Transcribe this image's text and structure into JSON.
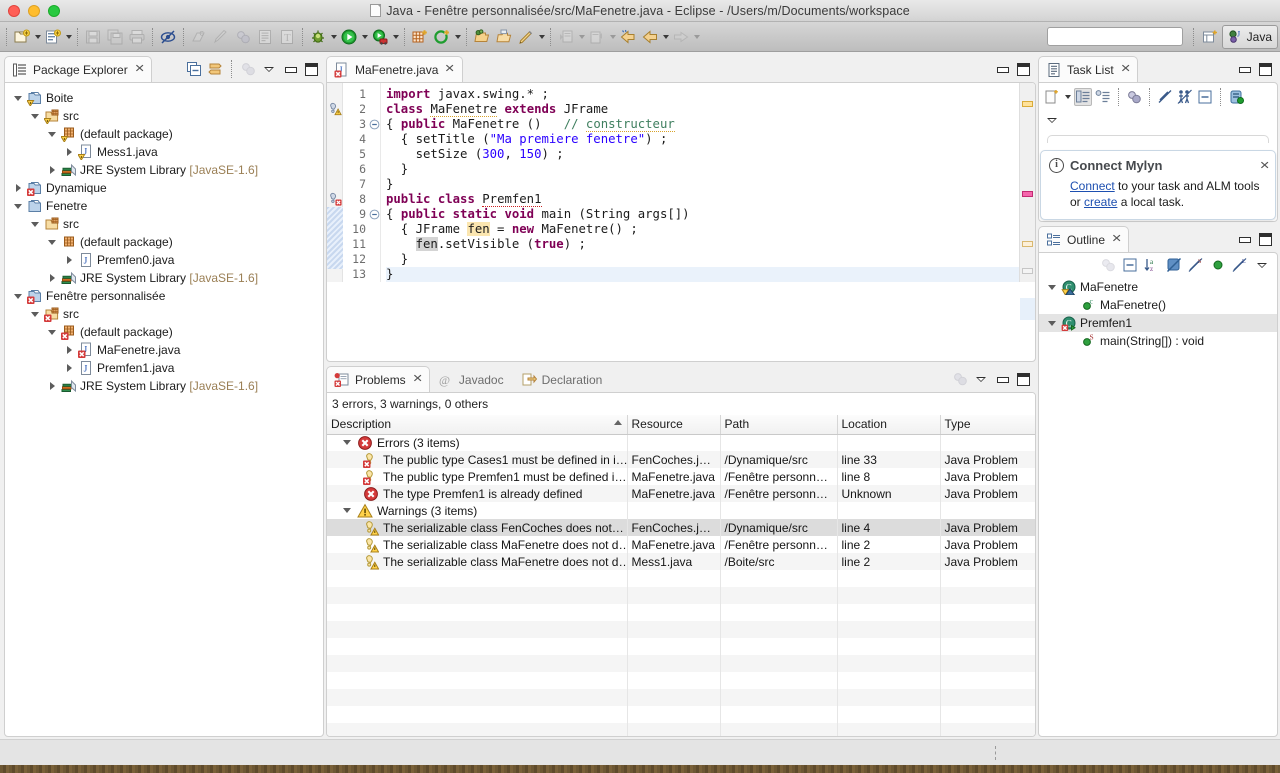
{
  "window": {
    "title": "Java - Fenêtre personnalisée/src/MaFenetre.java - Eclipse - /Users/m/Documents/workspace",
    "perspective_label": "Java"
  },
  "toolbar": {
    "search_placeholder": "",
    "search_value": "",
    "buttons": [
      {
        "name": "new-wizard",
        "label": "New"
      },
      {
        "name": "new-java-class",
        "label": "New Java Class"
      },
      {
        "name": "save",
        "label": "Save"
      },
      {
        "name": "save-all",
        "label": "Save All"
      },
      {
        "name": "print",
        "label": "Print"
      },
      {
        "name": "toggle-mark-occurrences",
        "label": "Toggle Mark Occurrences"
      },
      {
        "name": "new-java-package",
        "label": "New Java Package"
      },
      {
        "name": "externalize-strings",
        "label": "Externalize Strings"
      },
      {
        "name": "open-task",
        "label": "Open Task"
      },
      {
        "name": "open-type",
        "label": "Open Type"
      },
      {
        "name": "open-type-hierarchy",
        "label": "Open Type Hierarchy"
      },
      {
        "name": "debug",
        "label": "Debug"
      },
      {
        "name": "run",
        "label": "Run"
      },
      {
        "name": "run-external-tools",
        "label": "External Tools"
      },
      {
        "name": "new-java-project",
        "label": "New Java Project"
      },
      {
        "name": "new-java-element",
        "label": "New Java Element"
      },
      {
        "name": "open-resource",
        "label": "Open Resource"
      },
      {
        "name": "open-folder",
        "label": "Open Folder"
      },
      {
        "name": "search",
        "label": "Search"
      },
      {
        "name": "next-annotation",
        "label": "Next Annotation"
      },
      {
        "name": "previous-annotation",
        "label": "Previous Annotation"
      },
      {
        "name": "back",
        "label": "Back"
      },
      {
        "name": "forward-history",
        "label": "Forward"
      },
      {
        "name": "forward",
        "label": "Forward"
      }
    ]
  },
  "package_explorer": {
    "tab_label": "Package Explorer",
    "toolbar": [
      {
        "name": "collapse-all",
        "label": "Collapse All"
      },
      {
        "name": "link-with-editor",
        "label": "Link with Editor"
      },
      {
        "name": "view-menu-extra",
        "label": "Focus on Active Task"
      },
      {
        "name": "view-menu",
        "label": "View Menu"
      },
      {
        "name": "minimize",
        "label": "Minimize"
      },
      {
        "name": "maximize",
        "label": "Maximize"
      }
    ],
    "tree": [
      {
        "label": "Boite",
        "indent": 0,
        "twist": "open",
        "icon": "project-warning-icon"
      },
      {
        "label": "src",
        "indent": 1,
        "twist": "open",
        "icon": "source-folder-warning-icon"
      },
      {
        "label": "(default package)",
        "indent": 2,
        "twist": "open",
        "icon": "package-warning-icon"
      },
      {
        "label": "Mess1.java",
        "indent": 3,
        "twist": "closed",
        "icon": "java-file-warning-icon"
      },
      {
        "label": "JRE System Library",
        "suffix": "[JavaSE-1.6]",
        "indent": 2,
        "twist": "closed",
        "icon": "library-icon"
      },
      {
        "label": "Dynamique",
        "indent": 0,
        "twist": "closed",
        "icon": "project-error-icon"
      },
      {
        "label": "Fenetre",
        "indent": 0,
        "twist": "open",
        "icon": "project-icon"
      },
      {
        "label": "src",
        "indent": 1,
        "twist": "open",
        "icon": "source-folder-icon"
      },
      {
        "label": "(default package)",
        "indent": 2,
        "twist": "open",
        "icon": "package-icon"
      },
      {
        "label": "Premfen0.java",
        "indent": 3,
        "twist": "closed",
        "icon": "java-file-icon"
      },
      {
        "label": "JRE System Library",
        "suffix": "[JavaSE-1.6]",
        "indent": 2,
        "twist": "closed",
        "icon": "library-icon"
      },
      {
        "label": "Fenêtre personnalisée",
        "indent": 0,
        "twist": "open",
        "icon": "project-error-icon"
      },
      {
        "label": "src",
        "indent": 1,
        "twist": "open",
        "icon": "source-folder-error-icon"
      },
      {
        "label": "(default package)",
        "indent": 2,
        "twist": "open",
        "icon": "package-error-icon"
      },
      {
        "label": "MaFenetre.java",
        "indent": 3,
        "twist": "closed",
        "icon": "java-file-error-icon"
      },
      {
        "label": "Premfen1.java",
        "indent": 3,
        "twist": "closed",
        "icon": "java-file-icon"
      },
      {
        "label": "JRE System Library",
        "suffix": "[JavaSE-1.6]",
        "indent": 2,
        "twist": "closed",
        "icon": "library-icon"
      }
    ]
  },
  "editor": {
    "tab_label": "MaFenetre.java",
    "minimize_label": "Minimize",
    "maximize_label": "Maximize",
    "lines": [
      {
        "n": "1",
        "fold": "",
        "marker": ""
      },
      {
        "n": "2",
        "fold": "",
        "marker": "warning"
      },
      {
        "n": "3",
        "fold": "collapse",
        "marker": ""
      },
      {
        "n": "4",
        "fold": "",
        "marker": ""
      },
      {
        "n": "5",
        "fold": "",
        "marker": ""
      },
      {
        "n": "6",
        "fold": "",
        "marker": ""
      },
      {
        "n": "7",
        "fold": "",
        "marker": ""
      },
      {
        "n": "8",
        "fold": "",
        "marker": "error"
      },
      {
        "n": "9",
        "fold": "collapse",
        "marker": ""
      },
      {
        "n": "10",
        "fold": "",
        "marker": ""
      },
      {
        "n": "11",
        "fold": "",
        "marker": ""
      },
      {
        "n": "12",
        "fold": "",
        "marker": ""
      },
      {
        "n": "13",
        "fold": "",
        "marker": ""
      }
    ],
    "source_text": [
      "import javax.swing.* ;",
      "class MaFenetre extends JFrame",
      "{ public MaFenetre ()   // constructeur",
      "  { setTitle (\"Ma premiere fenetre\") ;",
      "    setSize (300, 150) ;",
      "  }",
      "}",
      "public class Premfen1",
      "{ public static void main (String args[])",
      "  { JFrame fen = new MaFenetre() ;",
      "    fen.setVisible (true) ;",
      "  }",
      "}"
    ]
  },
  "task_list": {
    "tab_label": "Task List",
    "toolbar": [
      {
        "name": "new-task",
        "label": "New Task"
      },
      {
        "name": "categorized-presentation",
        "label": "Categorized"
      },
      {
        "name": "scheduled-presentation",
        "label": "Scheduled"
      },
      {
        "name": "focus-on-workweek",
        "label": "Focus on Workweek"
      },
      {
        "name": "filter-completed-tasks",
        "label": "Filter Completed Tasks"
      },
      {
        "name": "show-my-tasks",
        "label": "Show My Tasks"
      },
      {
        "name": "collapse-all",
        "label": "Collapse All"
      },
      {
        "name": "synchronize-changed",
        "label": "Synchronize Changed"
      },
      {
        "name": "view-menu",
        "label": "View Menu"
      }
    ],
    "notification": {
      "title": "Connect Mylyn",
      "text_before_link1": "",
      "link1": "Connect",
      "text_middle": " to your task and ALM tools or ",
      "link2": "create",
      "text_after": " a local task.",
      "close_label": "Close"
    }
  },
  "outline": {
    "tab_label": "Outline",
    "toolbar": [
      {
        "name": "focus-on-active-task",
        "label": "Focus on Active Task"
      },
      {
        "name": "collapse-all",
        "label": "Collapse All"
      },
      {
        "name": "sort",
        "label": "Sort"
      },
      {
        "name": "hide-fields",
        "label": "Hide Fields"
      },
      {
        "name": "hide-static-fields",
        "label": "Hide Static Fields and Methods"
      },
      {
        "name": "hide-non-public",
        "label": "Hide Non-Public Members"
      },
      {
        "name": "hide-local-types",
        "label": "Hide Local Types"
      },
      {
        "name": "view-menu",
        "label": "View Menu"
      }
    ],
    "tree": [
      {
        "label": "MaFenetre",
        "indent": 0,
        "twist": "open",
        "icon": "class-warning-icon",
        "selected": false
      },
      {
        "label": "MaFenetre()",
        "indent": 1,
        "twist": "none",
        "icon": "constructor-icon",
        "badge": "c",
        "selected": false
      },
      {
        "label": "Premfen1",
        "indent": 0,
        "twist": "open",
        "icon": "class-error-icon",
        "selected": true
      },
      {
        "label": "main(String[]) : void",
        "indent": 1,
        "twist": "none",
        "icon": "method-icon",
        "badge": "S",
        "selected": false
      }
    ]
  },
  "problems": {
    "tabs": [
      {
        "label": "Problems",
        "active": true,
        "icon": "problems-icon"
      },
      {
        "label": "Javadoc",
        "active": false,
        "icon": "javadoc-icon"
      },
      {
        "label": "Declaration",
        "active": false,
        "icon": "declaration-icon"
      }
    ],
    "toolbar": [
      {
        "name": "focus-on-active-task",
        "label": "Focus on Active Task"
      },
      {
        "name": "view-menu",
        "label": "View Menu"
      },
      {
        "name": "minimize",
        "label": "Minimize"
      },
      {
        "name": "maximize",
        "label": "Maximize"
      }
    ],
    "summary": "3 errors, 3 warnings, 0 others",
    "columns": [
      "Description",
      "Resource",
      "Path",
      "Location",
      "Type"
    ],
    "sorted_column": "Description",
    "rows": [
      {
        "kind": "group",
        "icon": "error-icon",
        "description": "Errors (3 items)",
        "resource": "",
        "path": "",
        "location": "",
        "type": "",
        "selected": false
      },
      {
        "kind": "item",
        "icon": "error-quickfix-icon",
        "description": "The public type Cases1 must be defined in i…",
        "resource": "FenCoches.java",
        "path": "/Dynamique/src",
        "location": "line 33",
        "type": "Java Problem",
        "selected": false
      },
      {
        "kind": "item",
        "icon": "error-quickfix-icon",
        "description": "The public type Premfen1 must be defined i…",
        "resource": "MaFenetre.java",
        "path": "/Fenêtre personnali…",
        "location": "line 8",
        "type": "Java Problem",
        "selected": false
      },
      {
        "kind": "item",
        "icon": "error-icon",
        "description": "The type Premfen1 is already defined",
        "resource": "MaFenetre.java",
        "path": "/Fenêtre personnali…",
        "location": "Unknown",
        "type": "Java Problem",
        "selected": false
      },
      {
        "kind": "group",
        "icon": "warning-icon",
        "description": "Warnings (3 items)",
        "resource": "",
        "path": "",
        "location": "",
        "type": "",
        "selected": false
      },
      {
        "kind": "item",
        "icon": "warning-quickfix-icon",
        "description": "The serializable class FenCoches does not…",
        "resource": "FenCoches.java",
        "path": "/Dynamique/src",
        "location": "line 4",
        "type": "Java Problem",
        "selected": true
      },
      {
        "kind": "item",
        "icon": "warning-quickfix-icon",
        "description": "The serializable class MaFenetre does not d…",
        "resource": "MaFenetre.java",
        "path": "/Fenêtre personnali…",
        "location": "line 2",
        "type": "Java Problem",
        "selected": false
      },
      {
        "kind": "item",
        "icon": "warning-quickfix-icon",
        "description": "The serializable class MaFenetre does not d…",
        "resource": "Mess1.java",
        "path": "/Boite/src",
        "location": "line 2",
        "type": "Java Problem",
        "selected": false
      }
    ]
  },
  "colors": {
    "accent_blue": "#1d4fb0",
    "error_red": "#cc2222",
    "warning_amber": "#e0a52a",
    "keyword_purple": "#7f0055",
    "string_blue": "#2a00ff",
    "comment_green": "#3f7f5f",
    "selection_gray": "#dcdcdc"
  }
}
